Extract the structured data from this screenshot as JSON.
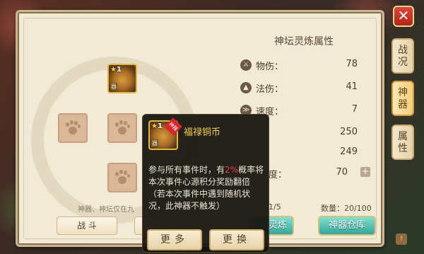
{
  "attributes": {
    "title": "神坛灵炼属性",
    "rows": [
      {
        "label": "物伤：",
        "value": "78",
        "icon": "physical-icon"
      },
      {
        "label": "法伤：",
        "value": "41",
        "icon": "magic-icon"
      },
      {
        "label": "速度：",
        "value": "7",
        "icon": "speed-icon"
      },
      {
        "label": "",
        "value": "250",
        "icon": "stat-icon"
      },
      {
        "label": "",
        "value": "249",
        "icon": "stat-icon"
      },
      {
        "label": "度：",
        "value": "70",
        "icon": ""
      }
    ]
  },
  "side_tabs": [
    {
      "label": "战况",
      "active": false
    },
    {
      "label": "神器",
      "active": true
    },
    {
      "label": "属性",
      "active": false
    }
  ],
  "slot_item": {
    "level": "1",
    "tag": "器"
  },
  "hint_text": "神器、神坛仅在九",
  "counts": {
    "slot_progress": "1/5",
    "quantity_label": "数量：",
    "quantity": "20/100"
  },
  "buttons": {
    "battle": "战  斗",
    "refine": "灵炼",
    "artifact_warehouse": "神器仓库"
  },
  "popup": {
    "item_name": "福禄铜币",
    "level": "1",
    "tag": "器",
    "badge": "神器",
    "desc_before": "参与所有事件时，有",
    "desc_highlight": "2%",
    "desc_after": "概率将本次事件心源积分奖励翻倍（若本次事件中遇到随机状况，此神器不触发）",
    "more_button": "更多",
    "replace_button": "更换"
  },
  "colors": {
    "highlight": "#ef3b46",
    "item_name": "#f6d04a",
    "green_button": "#33a79a"
  }
}
